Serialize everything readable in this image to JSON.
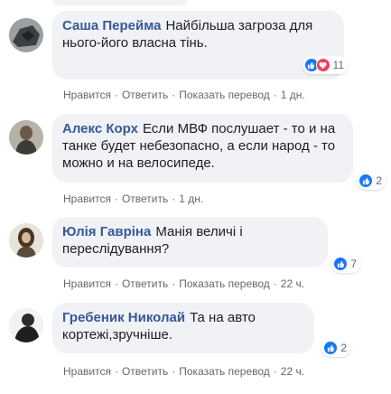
{
  "comments": [
    {
      "author": "Саша Перейма",
      "text": "Найбільша загроза для нього-його власна тінь.",
      "reaction_count": "11",
      "actions": {
        "like": "Нравится",
        "reply": "Ответить",
        "translate": "Показать перевод",
        "time": "1 дн."
      }
    },
    {
      "author": "Алекс Корх",
      "text": "Если МВФ послушает - то и на танке будет небезопасно, а если народ - то можно и на велосипеде.",
      "reaction_count": "2",
      "actions": {
        "like": "Нравится",
        "reply": "Ответить",
        "time": "1 дн."
      }
    },
    {
      "author": "Юлія Гавріна",
      "text": "Манія величі і переслідування?",
      "reaction_count": "7",
      "actions": {
        "like": "Нравится",
        "reply": "Ответить",
        "translate": "Показать перевод",
        "time": "22 ч."
      }
    },
    {
      "author": "Гребеник Николай",
      "text": "Та на авто кортежі,зручніше.",
      "reaction_count": "2",
      "actions": {
        "like": "Нравится",
        "reply": "Ответить",
        "translate": "Показать перевод",
        "time": "22 ч."
      }
    }
  ],
  "colors": {
    "author": "#385898",
    "bubble": "#f0f2f5",
    "meta": "#65676b",
    "like": "#1877f2",
    "love": "#f33e58"
  },
  "icons": {
    "like": "thumbs-up-icon",
    "love": "heart-icon"
  }
}
